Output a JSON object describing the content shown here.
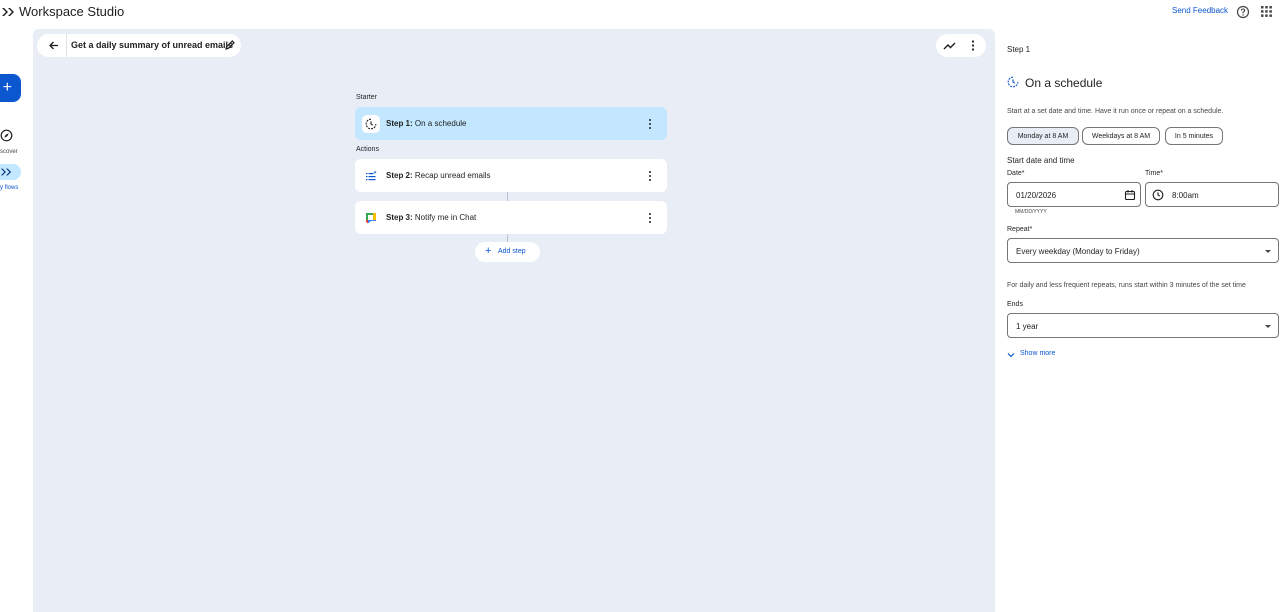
{
  "app": {
    "title": "Workspace Studio",
    "send_feedback": "Send Feedback"
  },
  "nav": {
    "new_label": "+",
    "discover_label": "scover",
    "my_flows_label": "y flows"
  },
  "flow": {
    "title": "Get a daily summary of unread emails"
  },
  "canvas": {
    "starter_label": "Starter",
    "actions_label": "Actions",
    "steps": [
      {
        "prefix": "Step 1:",
        "name": "On a schedule",
        "icon": "schedule-icon"
      },
      {
        "prefix": "Step 2:",
        "name": "Recap unread emails",
        "icon": "recap-list-icon"
      },
      {
        "prefix": "Step 3:",
        "name": "Notify me in Chat",
        "icon": "google-chat-icon"
      }
    ],
    "add_step": "Add step"
  },
  "panel": {
    "step_label": "Step 1",
    "title": "On a schedule",
    "description": "Start at a set date and time. Have it run once or repeat on a schedule.",
    "chips": [
      "Monday at 8 AM",
      "Weekdays at 8 AM",
      "In 5 minutes"
    ],
    "section_title": "Start date and time",
    "date_label": "Date*",
    "date_value": "01/20/2026",
    "date_hint": "MM/DD/YYYY",
    "time_label": "Time*",
    "time_value": "8:00am",
    "repeat_label": "Repeat*",
    "repeat_value": "Every weekday (Monday to Friday)",
    "note": "For daily and less frequent repeats, runs start within 3 minutes of the set time",
    "ends_label": "Ends",
    "ends_value": "1 year",
    "show_more": "Show more"
  },
  "colors": {
    "accent": "#0b57d0",
    "canvas_bg": "#e8edf6",
    "active_step": "#c2e7ff"
  }
}
